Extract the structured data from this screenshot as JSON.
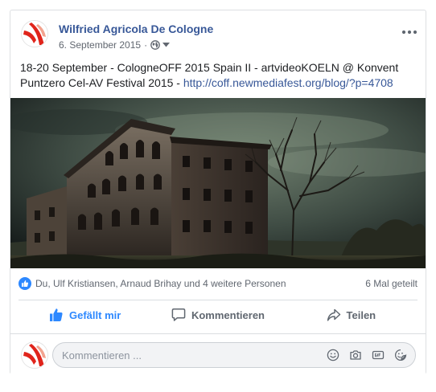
{
  "post": {
    "author": "Wilfried Agricola De Cologne",
    "date": "6. September 2015",
    "meta_separator": "·",
    "privacy_icon": "globe-icon",
    "audience_dropdown_icon": "caret-down-icon",
    "more_icon": "ellipsis-icon",
    "text": "18-20 September - CologneOFF 2015 Spain II - artvideoKOELN @ Konvent Puntzero Cel-AV Festival 2015 - ",
    "link": "http://coff.newmediafest.org/blog/?p=4708",
    "photo_subject": "old stone building under dark sky"
  },
  "reactions": {
    "icon": "like-bubble-icon",
    "summary": "Du, Ulf Kristiansen, Arnaud Brihay und 4 weitere Personen",
    "shares": "6 Mal geteilt"
  },
  "actions": {
    "like": "Gefällt mir",
    "comment": "Kommentieren",
    "share": "Teilen"
  },
  "comment_box": {
    "placeholder": "Kommentieren ...",
    "tools": [
      "emoji-icon",
      "camera-icon",
      "gif-icon",
      "sticker-icon"
    ]
  },
  "colors": {
    "link": "#385898",
    "like_active": "#2d88ff",
    "muted": "#616770",
    "border": "#dddfe2"
  }
}
